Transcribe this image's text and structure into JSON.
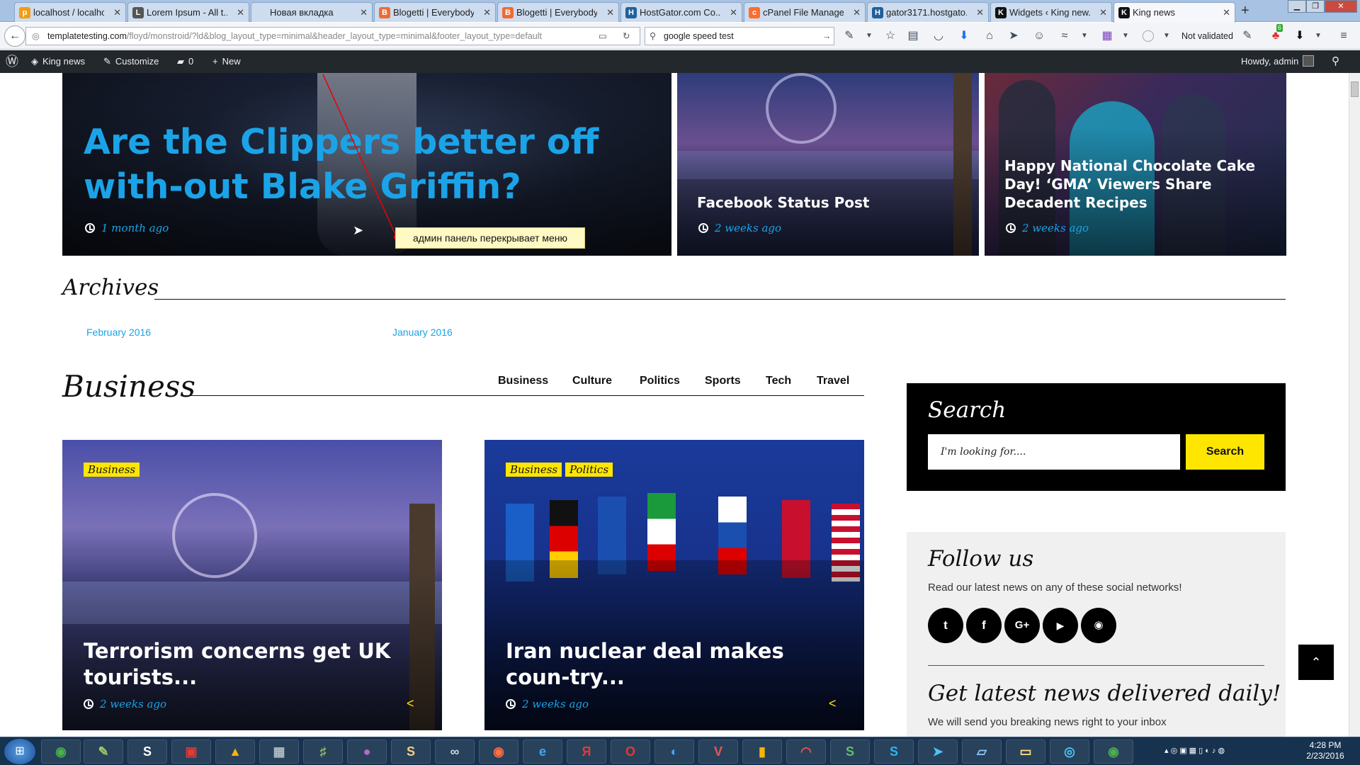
{
  "browser": {
    "tabs": [
      {
        "title": "localhost / localhos...",
        "icon": "phpmyadmin-icon",
        "color": "#f39c12",
        "glyph": "p"
      },
      {
        "title": "Lorem Ipsum - All t...",
        "icon": "lipsum-icon",
        "color": "#555555",
        "glyph": "L"
      },
      {
        "title": "Новая вкладка",
        "icon": "blank-page-icon",
        "color": "#cddcee",
        "glyph": ""
      },
      {
        "title": "Blogetti | Everybody...",
        "icon": "blogger-icon",
        "color": "#f06a35",
        "glyph": "B"
      },
      {
        "title": "Blogetti | Everybody...",
        "icon": "blogger-icon",
        "color": "#f06a35",
        "glyph": "B"
      },
      {
        "title": "HostGator.com Co...",
        "icon": "hostgator-icon",
        "color": "#1f5f9c",
        "glyph": "H"
      },
      {
        "title": "cPanel File Manage...",
        "icon": "cpanel-icon",
        "color": "#ff6c2c",
        "glyph": "c"
      },
      {
        "title": "gator3171.hostgato...",
        "icon": "hostgator-icon",
        "color": "#1f5f9c",
        "glyph": "H"
      },
      {
        "title": "Widgets ‹ King new...",
        "icon": "king-news-icon",
        "color": "#111111",
        "glyph": "K"
      },
      {
        "title": "King news",
        "icon": "king-news-icon",
        "color": "#111111",
        "glyph": "K",
        "active": true
      }
    ],
    "url_host": "templatetesting.com",
    "url_path": "/floyd/monstroid/?ld&blog_layout_type=minimal&header_layout_type=minimal&footer_layout_type=default",
    "search_value": "google speed test",
    "not_validated": "Not validated",
    "badge_count": "6"
  },
  "adminbar": {
    "site_name": "King news",
    "customize": "Customize",
    "comments_count": "0",
    "new_label": "New",
    "howdy": "Howdy, admin"
  },
  "hero": {
    "main_title": "Are the Clippers better off with-out Blake Griffin?",
    "main_time": "1 month ago",
    "card2_title": "Facebook Status Post",
    "card2_time": "2 weeks ago",
    "card3_title": "Happy National Chocolate Cake Day! ‘GMA’ Viewers Share Decadent Recipes",
    "card3_time": "2 weeks ago",
    "annotation": "админ панель перекрывает меню"
  },
  "archives": {
    "heading": "Archives",
    "links": [
      "February 2016",
      "January 2016"
    ]
  },
  "business": {
    "heading": "Business",
    "tabs": [
      "Business",
      "Culture",
      "Politics",
      "Sports",
      "Tech",
      "Travel"
    ],
    "posts": [
      {
        "badges": [
          "Business"
        ],
        "title": "Terrorism concerns get UK tourists...",
        "time": "2 weeks ago"
      },
      {
        "badges": [
          "Business",
          "Politics"
        ],
        "title": "Iran nuclear deal makes coun-try...",
        "time": "2 weeks ago"
      }
    ]
  },
  "sidebar": {
    "search_title": "Search",
    "search_placeholder": "I'm looking for....",
    "search_button": "Search",
    "follow_title": "Follow us",
    "follow_text": "Read our latest news on any of these social networks!",
    "social": [
      {
        "name": "twitter",
        "glyph": "t"
      },
      {
        "name": "facebook",
        "glyph": "f"
      },
      {
        "name": "google-plus",
        "glyph": "G+"
      },
      {
        "name": "youtube",
        "glyph": "▶"
      },
      {
        "name": "rss",
        "glyph": "◉"
      }
    ],
    "news_title": "Get latest news delivered daily!",
    "news_text": "We will send you breaking news right to your inbox"
  },
  "taskbar": {
    "time": "4:28 PM",
    "date": "2/23/2016"
  },
  "colors": {
    "accent_blue": "#1ba3e8",
    "accent_yellow": "#ffe600",
    "admin_bar": "#23282d"
  }
}
